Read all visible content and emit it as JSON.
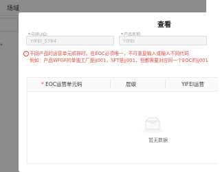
{
  "background": {
    "title": "场域"
  },
  "modal": {
    "title": "查看",
    "fields": {
      "uid": {
        "label": "中班UID:",
        "value": "YIFEI_5764"
      },
      "product": {
        "label": "产品名称:",
        "value": "YIFEI"
      }
    },
    "warning": {
      "line1": "不同产品的运营单元顺排时，在EOC必须唯一，不可重复输入或输入不同代码",
      "line2": "例如：产品WFGF的单独工厂是jj001，SFT是jj001，但都需要对应同一个EOC的jj001"
    },
    "table": {
      "headers": [
        "EOC运营单元码",
        "层级",
        "YIFEI运营"
      ],
      "empty_text": "暂无数据"
    }
  },
  "colors": {
    "accent_red": "#e0483e",
    "mask": "rgba(0,0,0,0.45)"
  },
  "icons": [
    "warning-circle-icon",
    "empty-box-icon"
  ]
}
